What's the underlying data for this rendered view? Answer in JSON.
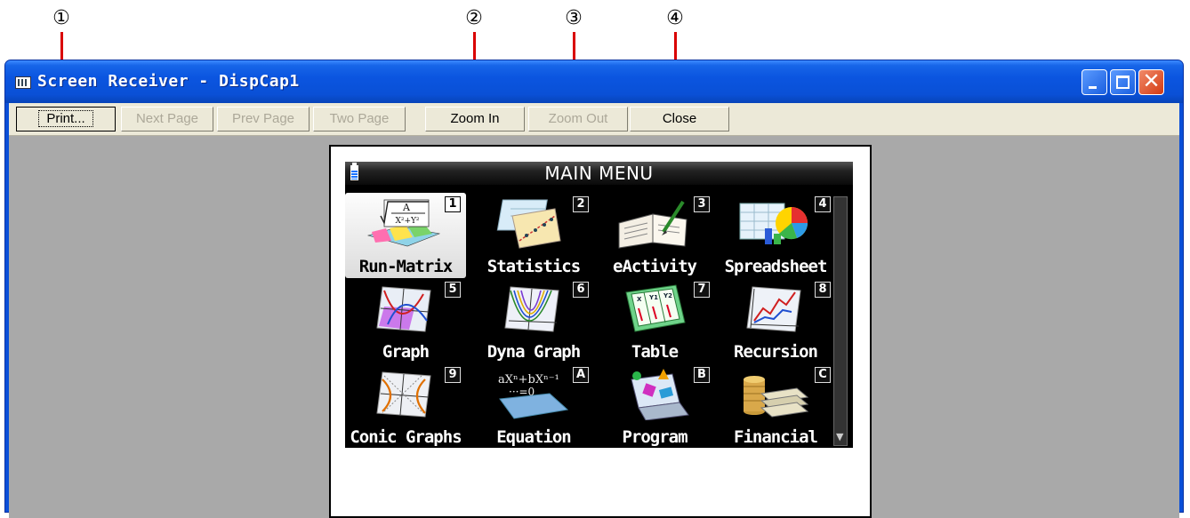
{
  "callouts": [
    "①",
    "②",
    "③",
    "④"
  ],
  "window": {
    "title": "Screen Receiver - DispCap1"
  },
  "toolbar": {
    "print": "Print...",
    "next_page": "Next Page",
    "prev_page": "Prev Page",
    "two_page": "Two Page",
    "zoom_in": "Zoom In",
    "zoom_out": "Zoom Out",
    "close": "Close"
  },
  "calculator": {
    "header": "MAIN MENU",
    "items": [
      {
        "label": "Run-Matrix",
        "key": "1",
        "icon": "run-matrix-icon"
      },
      {
        "label": "Statistics",
        "key": "2",
        "icon": "statistics-icon"
      },
      {
        "label": "eActivity",
        "key": "3",
        "icon": "eactivity-icon"
      },
      {
        "label": "Spreadsheet",
        "key": "4",
        "icon": "spreadsheet-icon"
      },
      {
        "label": "Graph",
        "key": "5",
        "icon": "graph-icon"
      },
      {
        "label": "Dyna Graph",
        "key": "6",
        "icon": "dyna-graph-icon"
      },
      {
        "label": "Table",
        "key": "7",
        "icon": "table-icon"
      },
      {
        "label": "Recursion",
        "key": "8",
        "icon": "recursion-icon"
      },
      {
        "label": "Conic Graphs",
        "key": "9",
        "icon": "conic-graphs-icon"
      },
      {
        "label": "Equation",
        "key": "A",
        "icon": "equation-icon"
      },
      {
        "label": "Program",
        "key": "B",
        "icon": "program-icon"
      },
      {
        "label": "Financial",
        "key": "C",
        "icon": "financial-icon"
      }
    ],
    "icon_text": {
      "run_matrix_top": "A",
      "run_matrix_bottom": "X²+Y²",
      "equation_top": "aXⁿ+bXⁿ⁻¹",
      "equation_bottom": "···=0",
      "table_cells": [
        "X",
        "Y1",
        "Y2"
      ]
    }
  },
  "colors": {
    "callout_line": "#d90000",
    "titlebar": "#0a50d6",
    "toolbar": "#ece9d8",
    "preview_bg": "#a9a9a9"
  }
}
